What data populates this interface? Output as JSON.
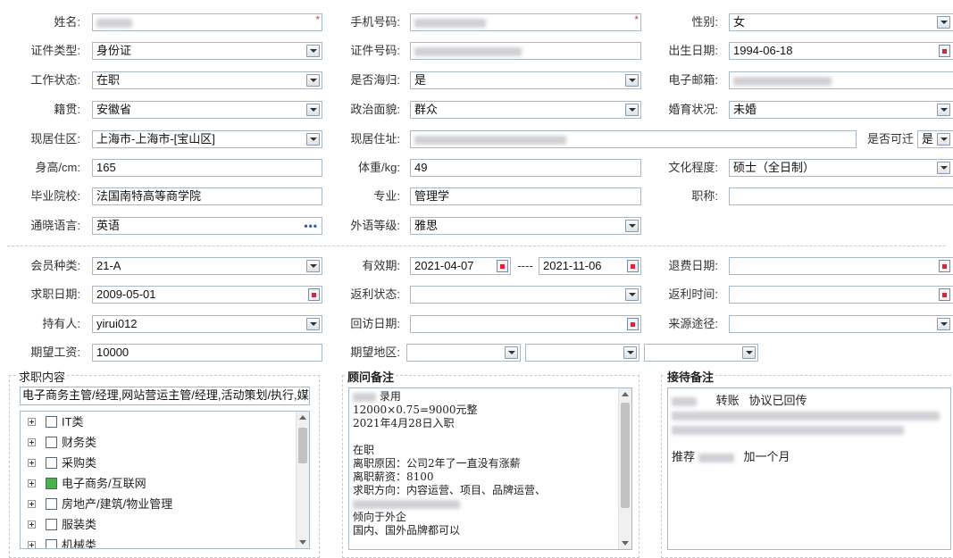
{
  "profile": {
    "name": {
      "label": "姓名:",
      "value": ""
    },
    "phone": {
      "label": "手机号码:",
      "value": ""
    },
    "gender": {
      "label": "性别:",
      "value": "女"
    },
    "id_type": {
      "label": "证件类型:",
      "value": "身份证"
    },
    "id_number": {
      "label": "证件号码:",
      "value": ""
    },
    "birth_date": {
      "label": "出生日期:",
      "value": "1994-06-18"
    },
    "work_status": {
      "label": "工作状态:",
      "value": "在职"
    },
    "returnee": {
      "label": "是否海归:",
      "value": "是"
    },
    "email": {
      "label": "电子邮箱:",
      "value": ""
    },
    "native_place": {
      "label": "籍贯:",
      "value": "安徽省"
    },
    "political_status": {
      "label": "政治面貌:",
      "value": "群众"
    },
    "marital_status": {
      "label": "婚育状况:",
      "value": "未婚"
    },
    "residence_area": {
      "label": "现居住区:",
      "value": "上海市-上海市-[宝山区]"
    },
    "residence_address": {
      "label": "现居住址:",
      "value": ""
    },
    "relocatable": {
      "label": "是否可迁",
      "value": "是"
    },
    "height": {
      "label": "身高/cm:",
      "value": "165"
    },
    "weight": {
      "label": "体重/kg:",
      "value": "49"
    },
    "education": {
      "label": "文化程度:",
      "value": "硕士（全日制）"
    },
    "school": {
      "label": "毕业院校:",
      "value": "法国南特高等商学院"
    },
    "major": {
      "label": "专业:",
      "value": "管理学"
    },
    "title": {
      "label": "职称:",
      "value": ""
    },
    "language": {
      "label": "通晓语言:",
      "value": "英语",
      "more_icon": "ellipsis-icon"
    },
    "language_level": {
      "label": "外语等级:",
      "value": "雅思"
    }
  },
  "membership": {
    "member_type": {
      "label": "会员种类:",
      "value": "21-A"
    },
    "validity": {
      "label": "有效期:",
      "start": "2021-04-07",
      "separator": "----",
      "end": "2021-11-06"
    },
    "refund_date": {
      "label": "退费日期:",
      "value": ""
    },
    "job_seek_date": {
      "label": "求职日期:",
      "value": "2009-05-01"
    },
    "rebate_status": {
      "label": "返利状态:",
      "value": ""
    },
    "rebate_time": {
      "label": "返利时间:",
      "value": ""
    },
    "holder": {
      "label": "持有人:",
      "value": "yirui012"
    },
    "follow_up_date": {
      "label": "回访日期:",
      "value": ""
    },
    "source": {
      "label": "来源途径:",
      "value": ""
    },
    "expected_salary": {
      "label": "期望工资:",
      "value": "10000"
    },
    "expected_region": {
      "label": "期望地区:",
      "values": [
        "",
        "",
        ""
      ]
    }
  },
  "job_content": {
    "title": "求职内容",
    "summary": "电子商务主管/经理,网站营运主管/经理,活动策划/执行,媒/",
    "tree": [
      {
        "label": "IT类",
        "checked": false
      },
      {
        "label": "财务类",
        "checked": false
      },
      {
        "label": "采购类",
        "checked": false
      },
      {
        "label": "电子商务/互联网",
        "checked": true
      },
      {
        "label": "房地产/建筑/物业管理",
        "checked": false
      },
      {
        "label": "服装类",
        "checked": false
      },
      {
        "label": "机械类",
        "checked": false
      }
    ]
  },
  "consultant_notes": {
    "title": "顾问备注",
    "lines": [
      "录用",
      "12000×0.75=9000元整",
      "2021年4月28日入职",
      "",
      "在职",
      "离职原因：公司2年了一直没有涨薪",
      "离职薪资：8100",
      "求职方向：内容运营、项目、品牌运营、",
      "",
      "倾向于外企",
      "国内、国外品牌都可以"
    ]
  },
  "reception_notes": {
    "title": "接待备注",
    "line1_a": "转账",
    "line1_b": "协议已回传",
    "line_recommend_a": "推荐",
    "line_recommend_b": "加一个月"
  },
  "colors": {
    "border": "#a9b8c8",
    "required": "#ee3333",
    "checked": "#4caf50"
  }
}
